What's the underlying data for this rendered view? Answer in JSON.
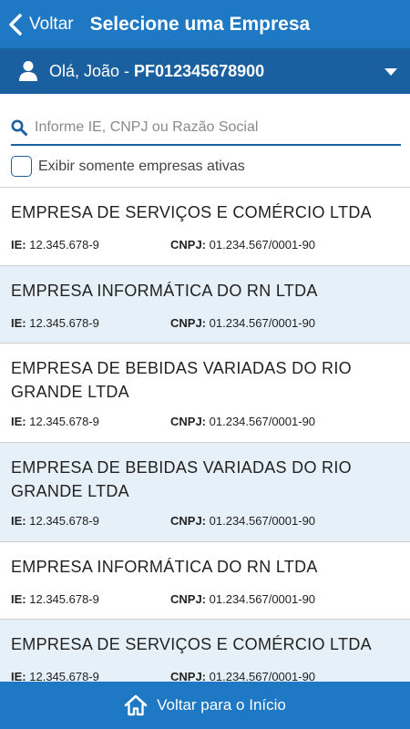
{
  "header": {
    "back_label": "Voltar",
    "title": "Selecione uma Empresa"
  },
  "user": {
    "greeting": "Olá, João - ",
    "code": "PF012345678900"
  },
  "search": {
    "placeholder": "Informe IE, CNPJ ou Razão Social"
  },
  "filter": {
    "label": "Exibir somente empresas ativas",
    "checked": false
  },
  "list": {
    "ie_label": "IE:",
    "cnpj_label": "CNPJ:",
    "items": [
      {
        "name": "EMPRESA DE SERVIÇOS E COMÉRCIO LTDA",
        "ie": "12.345.678-9",
        "cnpj": "01.234.567/0001-90"
      },
      {
        "name": "EMPRESA INFORMÁTICA DO RN LTDA",
        "ie": "12.345.678-9",
        "cnpj": "01.234.567/0001-90"
      },
      {
        "name": "EMPRESA DE BEBIDAS VARIADAS DO RIO GRANDE LTDA",
        "ie": "12.345.678-9",
        "cnpj": "01.234.567/0001-90"
      },
      {
        "name": "EMPRESA DE BEBIDAS VARIADAS DO RIO GRANDE LTDA",
        "ie": "12.345.678-9",
        "cnpj": "01.234.567/0001-90"
      },
      {
        "name": "EMPRESA INFORMÁTICA DO RN LTDA",
        "ie": "12.345.678-9",
        "cnpj": "01.234.567/0001-90"
      },
      {
        "name": "EMPRESA DE SERVIÇOS E COMÉRCIO LTDA",
        "ie": "12.345.678-9",
        "cnpj": "01.234.567/0001-90"
      }
    ]
  },
  "footer": {
    "label": "Voltar para o Início"
  },
  "colors": {
    "primary": "#1e78c3",
    "primary_dark": "#1a5fa0",
    "row_alt": "#e6f0f8"
  },
  "icons": {
    "back": "chevron-left-icon",
    "user": "user-icon",
    "dropdown": "caret-down-icon",
    "search": "search-icon",
    "home": "home-icon"
  }
}
